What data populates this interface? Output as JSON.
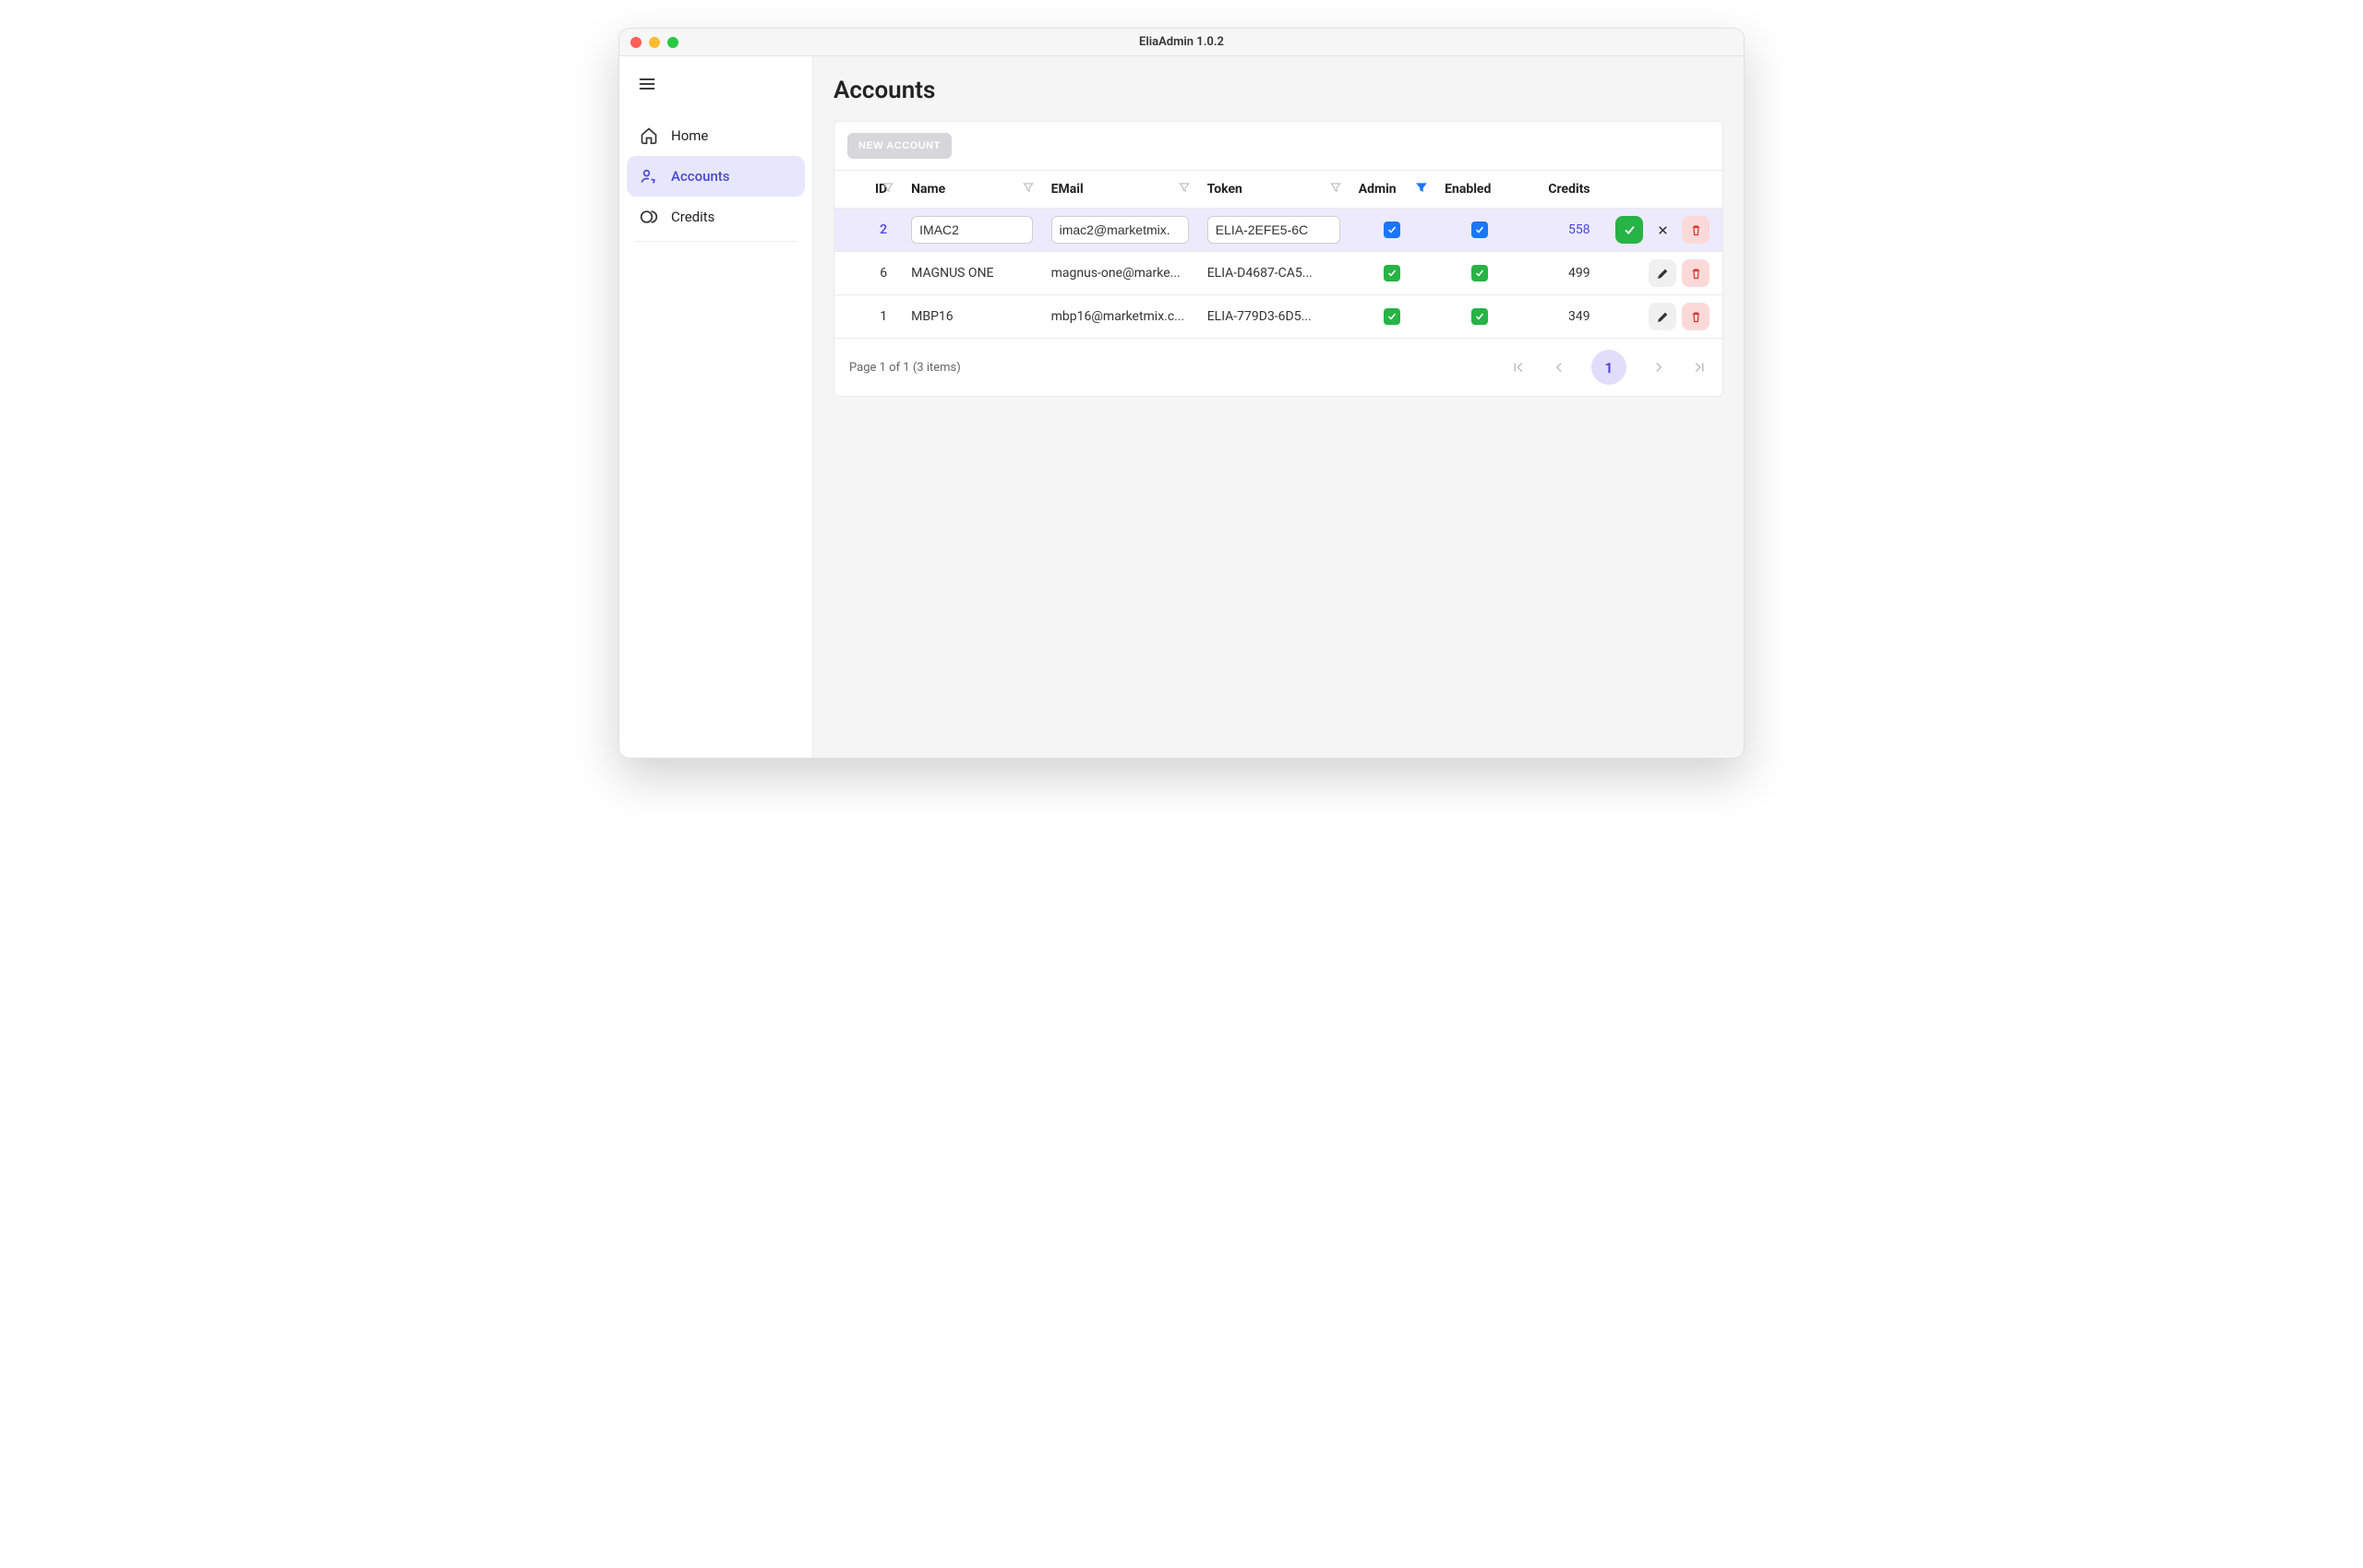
{
  "window": {
    "title": "EliaAdmin 1.0.2"
  },
  "page": {
    "title": "Accounts"
  },
  "sidebar": {
    "items": [
      {
        "label": "Home"
      },
      {
        "label": "Accounts"
      },
      {
        "label": "Credits"
      }
    ]
  },
  "toolbar": {
    "newAccount": "NEW ACCOUNT"
  },
  "columns": {
    "id": "ID",
    "name": "Name",
    "email": "EMail",
    "token": "Token",
    "admin": "Admin",
    "enabled": "Enabled",
    "credits": "Credits"
  },
  "rows": [
    {
      "id": "2",
      "name": "IMAC2",
      "email": "imac2@marketmix.",
      "token": "ELIA-2EFE5-6C",
      "admin": true,
      "enabled": true,
      "credits": "558",
      "editing": true,
      "selected": true
    },
    {
      "id": "6",
      "name": "MAGNUS ONE",
      "email": "magnus-one@marke...",
      "token": "ELIA-D4687-CA5...",
      "admin": true,
      "enabled": true,
      "credits": "499",
      "editing": false,
      "selected": false
    },
    {
      "id": "1",
      "name": "MBP16",
      "email": "mbp16@marketmix.c...",
      "token": "ELIA-779D3-6D5...",
      "admin": true,
      "enabled": true,
      "credits": "349",
      "editing": false,
      "selected": false
    }
  ],
  "pager": {
    "info": "Page 1 of 1 (3 items)",
    "current": "1"
  }
}
